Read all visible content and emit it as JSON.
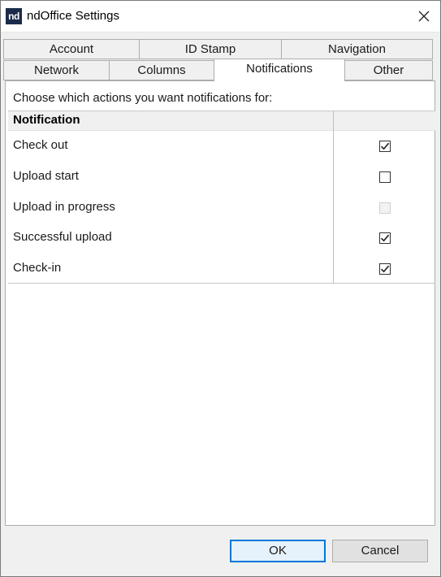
{
  "window": {
    "title": "ndOffice Settings",
    "logo_text": "nd"
  },
  "tabs_row1": [
    {
      "label": "Account"
    },
    {
      "label": "ID Stamp"
    },
    {
      "label": "Navigation"
    }
  ],
  "tabs_row2": [
    {
      "label": "Network"
    },
    {
      "label": "Columns"
    },
    {
      "label": "Notifications",
      "active": true
    },
    {
      "label": "Other"
    }
  ],
  "panel": {
    "hint": "Choose which actions you want notifications for:",
    "column_header": "Notification",
    "rows": [
      {
        "label": "Check out",
        "checked": true,
        "enabled": true
      },
      {
        "label": "Upload start",
        "checked": false,
        "enabled": true
      },
      {
        "label": "Upload in progress",
        "checked": false,
        "enabled": false
      },
      {
        "label": "Successful upload",
        "checked": true,
        "enabled": true
      },
      {
        "label": "Check-in",
        "checked": true,
        "enabled": true
      }
    ]
  },
  "buttons": {
    "ok": "OK",
    "cancel": "Cancel"
  }
}
